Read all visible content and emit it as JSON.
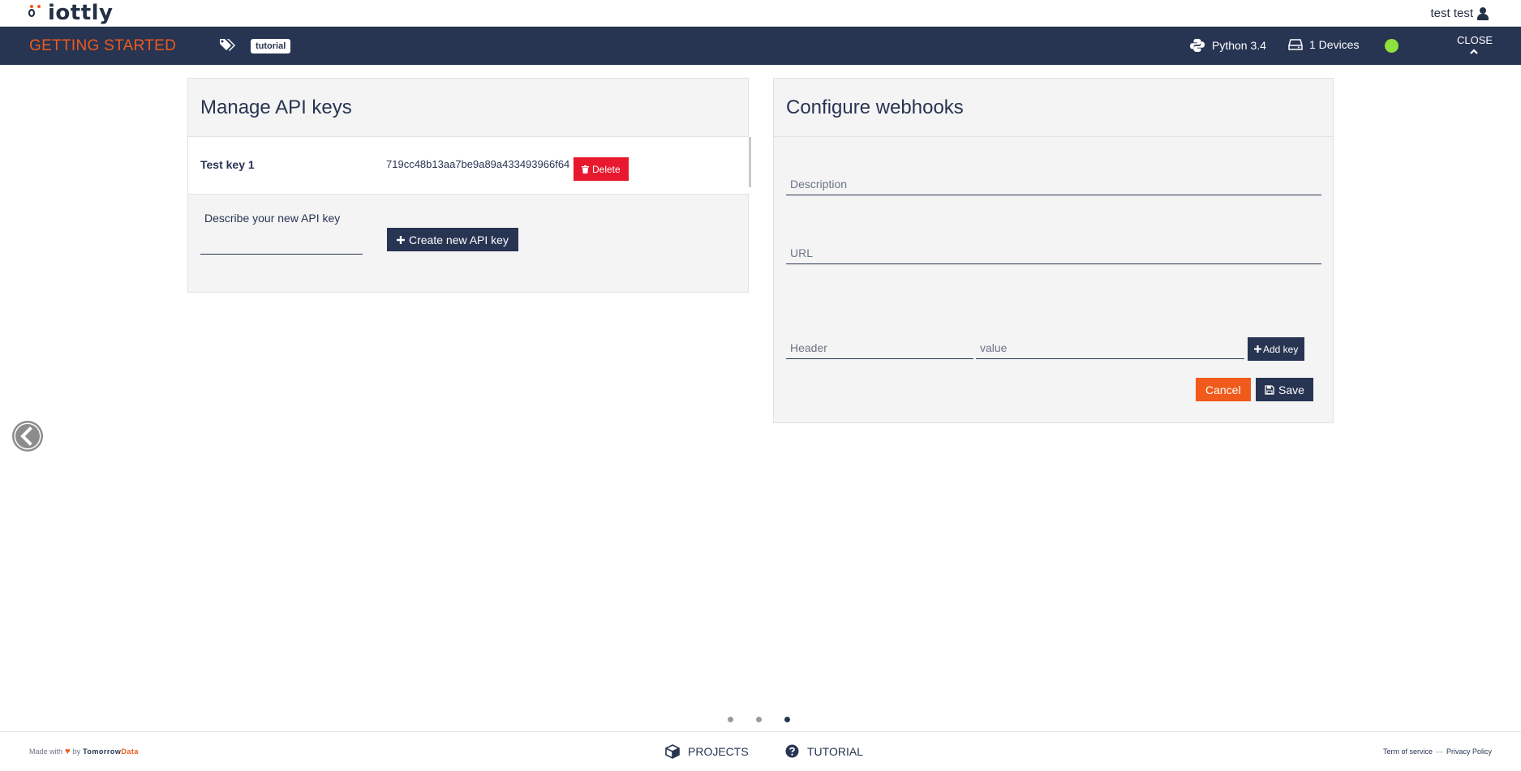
{
  "header": {
    "logo_text": "iottly",
    "user_name": "test test"
  },
  "nav": {
    "title": "GETTING STARTED",
    "tag": "tutorial",
    "python_label": "Python 3.4",
    "devices_label": "1 Devices",
    "status_color": "#8ee03a",
    "close_label": "CLOSE"
  },
  "api_keys": {
    "title": "Manage API keys",
    "keys": [
      {
        "name": "Test key 1",
        "value": "719cc48b13aa7be9a89a433493966f64",
        "delete_label": "Delete"
      }
    ],
    "new_key_label": "Describe your new API key",
    "new_key_value": "",
    "create_label": "Create new API key"
  },
  "webhooks": {
    "title": "Configure webhooks",
    "description_placeholder": "Description",
    "url_placeholder": "URL",
    "header_placeholder": "Header",
    "value_placeholder": "value",
    "add_key_label": "Add key",
    "cancel_label": "Cancel",
    "save_label": "Save"
  },
  "carousel": {
    "slide_count": 3,
    "active_index": 2
  },
  "footer": {
    "made_with": "Made with",
    "by": "by",
    "brand_part1": "Tomorrow",
    "brand_part2": "Data",
    "projects_label": "PROJECTS",
    "tutorial_label": "TUTORIAL",
    "terms_label": "Term of service",
    "separator": "—",
    "privacy_label": "Privacy Policy"
  },
  "colors": {
    "navy": "#273452",
    "orange": "#f05a1a",
    "danger": "#e8192f"
  }
}
